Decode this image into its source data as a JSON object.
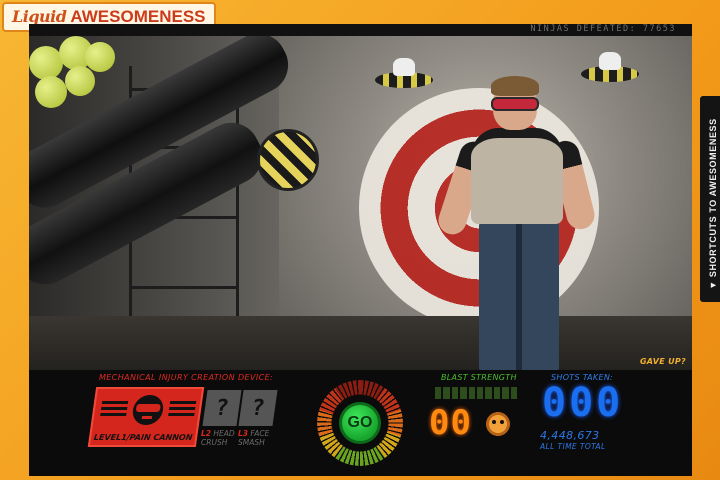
{
  "logo": {
    "part1": "Liquid",
    "part2": "AWESOMENESS"
  },
  "scorebar": {
    "ninjas_defeated": "NINJAS DEFEATED: 77653"
  },
  "scene": {
    "give_up": "GAVE UP?"
  },
  "device": {
    "title": "MECHANICAL INJURY CREATION DEVICE:",
    "level1_label": "LEVEL1/PAIN CANNON",
    "locked_glyph": "?",
    "level2_num": "L2",
    "level2_name_a": "HEAD",
    "level2_name_b": "CRUSH",
    "level3_num": "L3",
    "level3_name_a": "FACE",
    "level3_name_b": "SMASH"
  },
  "go_button": {
    "label": "GO"
  },
  "blast": {
    "title": "BLAST STRENGTH",
    "value": "00"
  },
  "shots": {
    "title": "SHOTS TAKEN:",
    "value": "000",
    "all_time_value": "4,448,673",
    "all_time_label": "ALL TIME TOTAL"
  },
  "side_tab": {
    "label": "▼ SHORTCUTS TO AWESOMENESS"
  },
  "colors": {
    "frame": "#f39a1a",
    "device_red": "#d5261d",
    "blast_orange": "#ff8a10",
    "shots_blue": "#1a6ff0",
    "go_green": "#17a52d"
  }
}
